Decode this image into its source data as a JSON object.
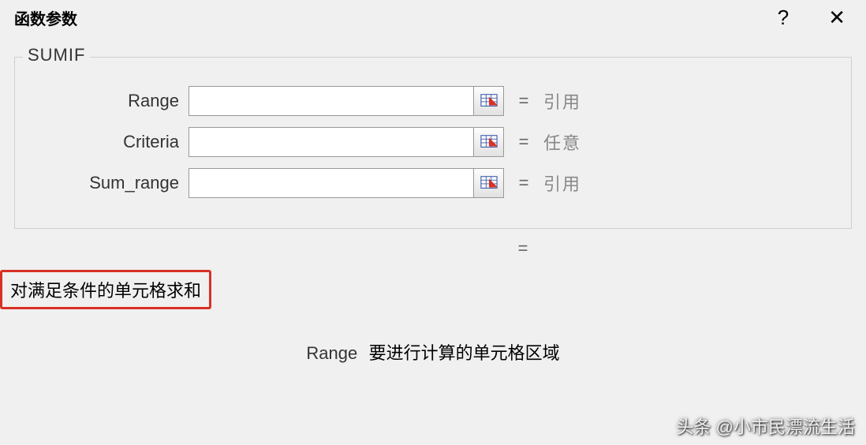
{
  "titlebar": {
    "title": "函数参数",
    "help": "?",
    "close": "✕"
  },
  "fieldset": {
    "legend": "SUMIF",
    "params": [
      {
        "label": "Range",
        "value": "",
        "hint": "引用"
      },
      {
        "label": "Criteria",
        "value": "",
        "hint": "任意"
      },
      {
        "label": "Sum_range",
        "value": "",
        "hint": "引用"
      }
    ]
  },
  "result": {
    "equals": "=",
    "value": ""
  },
  "description": "对满足条件的单元格求和",
  "help": {
    "param": "Range",
    "text": "要进行计算的单元格区域"
  },
  "eq": "=",
  "watermark": "头条 @小市民漂流生活"
}
